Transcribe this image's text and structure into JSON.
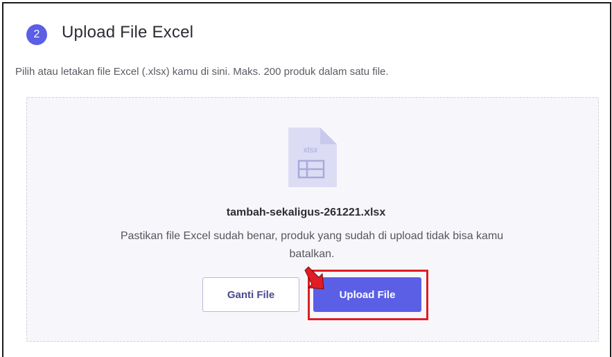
{
  "header": {
    "step_number": "2",
    "title": "Upload File Excel",
    "subtitle": "Pilih atau letakan file Excel (.xlsx) kamu di sini. Maks. 200 produk dalam satu file."
  },
  "dropzone": {
    "file_icon": "xlsx-file-icon",
    "file_icon_label": "xlsx",
    "file_name": "tambah-sekaligus-261221.xlsx",
    "note": "Pastikan file Excel sudah benar, produk yang sudah di upload tidak bisa kamu batalkan."
  },
  "actions": {
    "change_label": "Ganti File",
    "upload_label": "Upload File"
  },
  "colors": {
    "accent": "#5b5fe6",
    "highlight": "#e01c24",
    "file_icon": "#dcdcf5"
  }
}
